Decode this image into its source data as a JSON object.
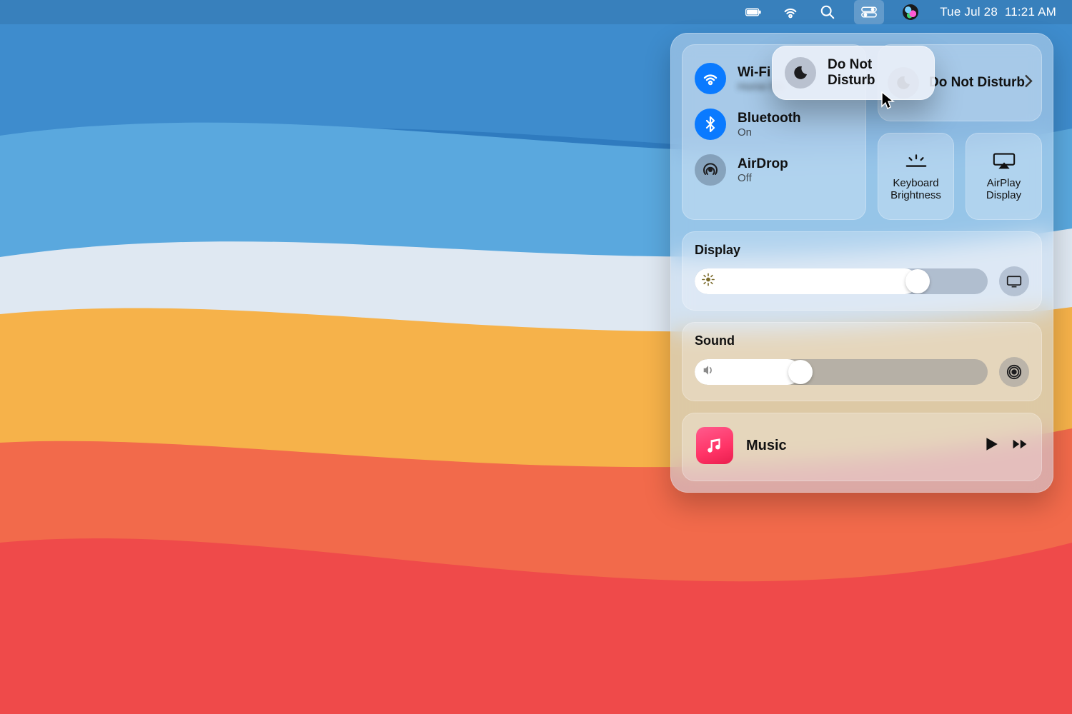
{
  "menubar": {
    "date": "Tue Jul 28",
    "time": "11:21 AM"
  },
  "cc": {
    "wifi": {
      "label": "Wi-Fi",
      "status": "Home-5G"
    },
    "bluetooth": {
      "label": "Bluetooth",
      "status": "On"
    },
    "airdrop": {
      "label": "AirDrop",
      "status": "Off"
    },
    "dnd_panel": {
      "label": "Do Not Disturb"
    },
    "keyboard": {
      "label_line1": "Keyboard",
      "label_line2": "Brightness"
    },
    "airplay": {
      "label_line1": "AirPlay",
      "label_line2": "Display"
    },
    "display": {
      "heading": "Display",
      "value_pct": 76
    },
    "sound": {
      "heading": "Sound",
      "value_pct": 36
    },
    "music": {
      "title": "Music"
    }
  },
  "dnd_float": {
    "label": "Do Not Disturb"
  }
}
